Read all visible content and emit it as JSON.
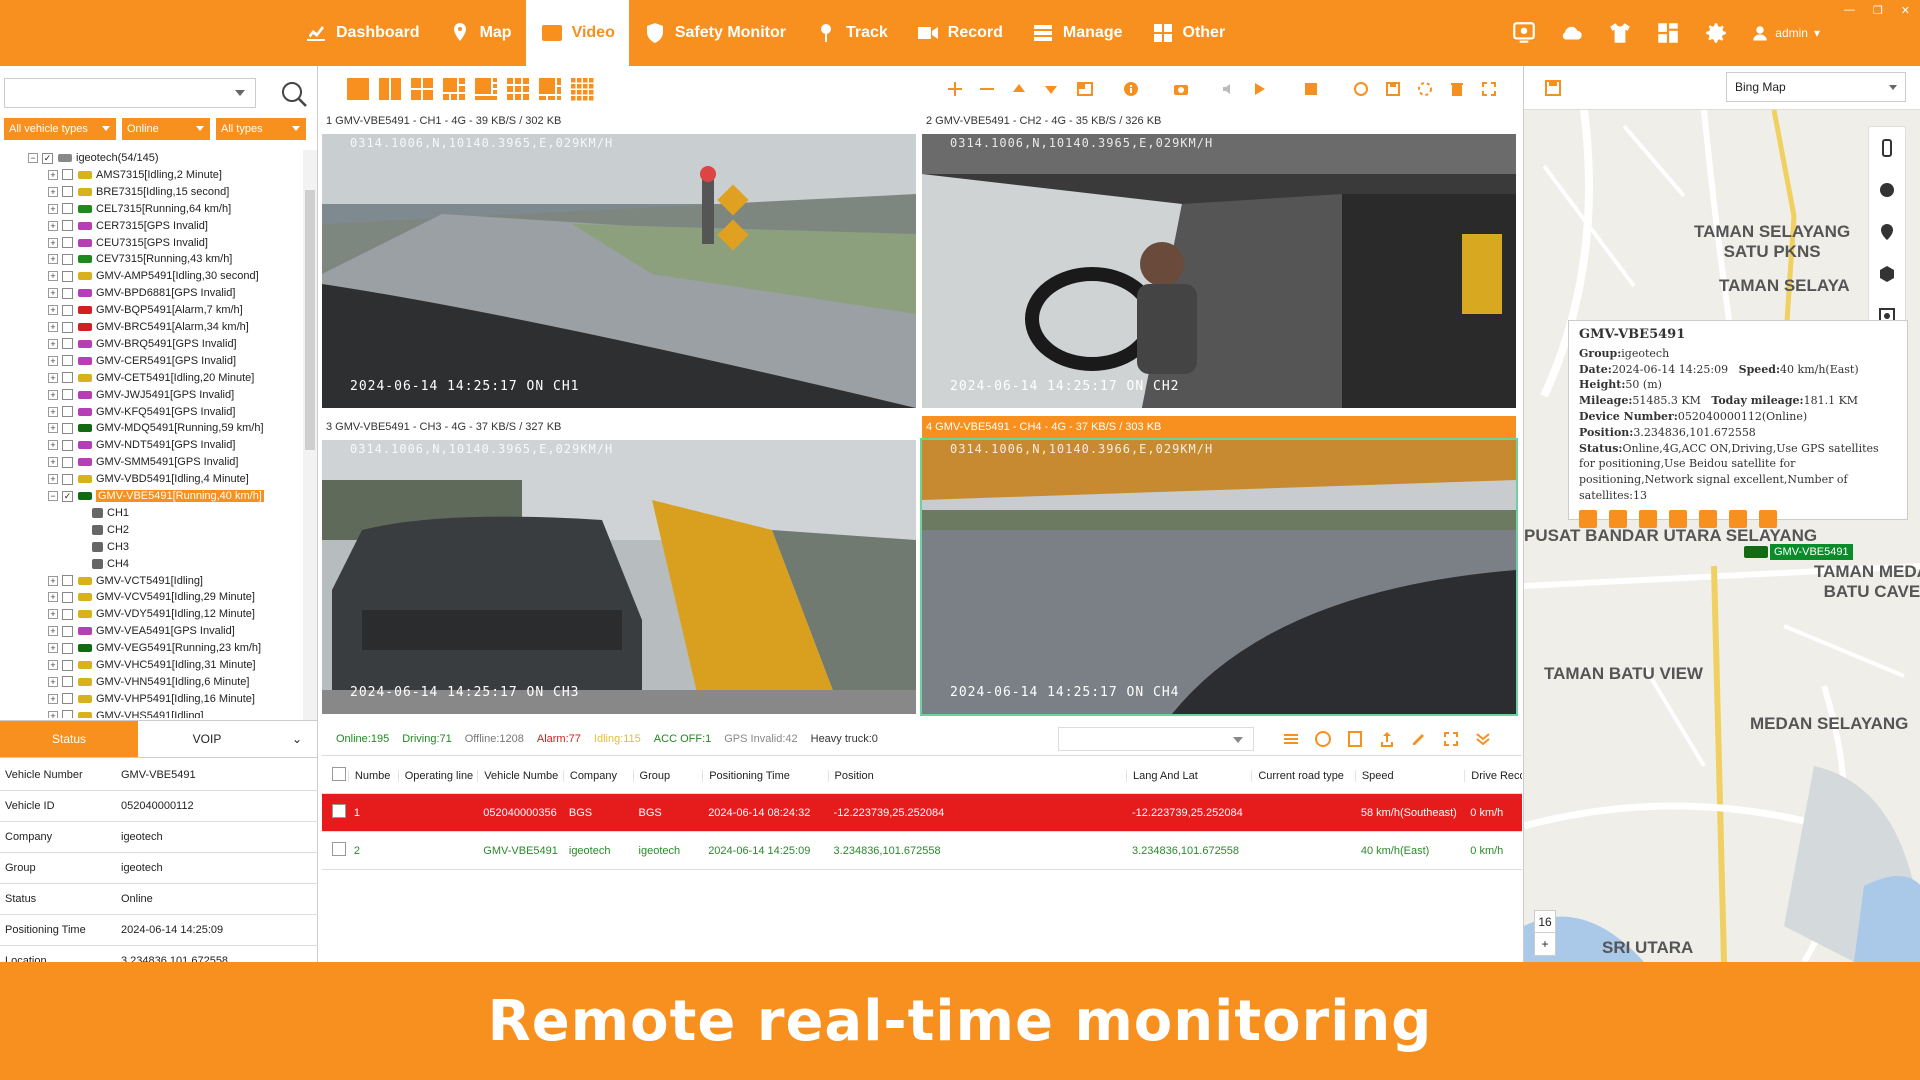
{
  "nav": {
    "items": [
      {
        "label": "Dashboard",
        "icon": "dashboard-icon",
        "active": false
      },
      {
        "label": "Map",
        "icon": "map-pin-icon",
        "active": false
      },
      {
        "label": "Video",
        "icon": "video-play-icon",
        "active": true
      },
      {
        "label": "Safety Monitor",
        "icon": "shield-icon",
        "active": false
      },
      {
        "label": "Track",
        "icon": "location-pin-icon",
        "active": false
      },
      {
        "label": "Record",
        "icon": "camera-icon",
        "active": false
      },
      {
        "label": "Manage",
        "icon": "manage-icon",
        "active": false
      },
      {
        "label": "Other",
        "icon": "grid-icon",
        "active": false
      }
    ],
    "user": "admin"
  },
  "left": {
    "filters": [
      "All vehicle types",
      "Online",
      "All types"
    ],
    "tree": {
      "root": "igeotech(54/145)",
      "vehicles": [
        {
          "label": "AMS7315[Idling,2 Minute]",
          "color": "#d7b21c"
        },
        {
          "label": "BRE7315[Idling,15 second]",
          "color": "#d7b21c"
        },
        {
          "label": "CEL7315[Running,64 km/h]",
          "color": "#1d8a1d"
        },
        {
          "label": "CER7315[GPS Invalid]",
          "color": "#b63fb6"
        },
        {
          "label": "CEU7315[GPS Invalid]",
          "color": "#b63fb6"
        },
        {
          "label": "CEV7315[Running,43 km/h]",
          "color": "#1d8a1d"
        },
        {
          "label": "GMV-AMP5491[Idling,30 second]",
          "color": "#d7b21c"
        },
        {
          "label": "GMV-BPD6881[GPS Invalid]",
          "color": "#b63fb6"
        },
        {
          "label": "GMV-BQP5491[Alarm,7 km/h]",
          "color": "#d21f1f"
        },
        {
          "label": "GMV-BRC5491[Alarm,34 km/h]",
          "color": "#d21f1f"
        },
        {
          "label": "GMV-BRQ5491[GPS Invalid]",
          "color": "#b63fb6"
        },
        {
          "label": "GMV-CER5491[GPS Invalid]",
          "color": "#b63fb6"
        },
        {
          "label": "GMV-CET5491[Idling,20 Minute]",
          "color": "#d7b21c"
        },
        {
          "label": "GMV-JWJ5491[GPS Invalid]",
          "color": "#b63fb6"
        },
        {
          "label": "GMV-KFQ5491[GPS Invalid]",
          "color": "#b63fb6"
        },
        {
          "label": "GMV-MDQ5491[Running,59 km/h]",
          "color": "#126b12"
        },
        {
          "label": "GMV-NDT5491[GPS Invalid]",
          "color": "#b63fb6"
        },
        {
          "label": "GMV-SMM5491[GPS Invalid]",
          "color": "#b63fb6"
        },
        {
          "label": "GMV-VBD5491[Idling,4 Minute]",
          "color": "#d7b21c"
        },
        {
          "label": "GMV-VBE5491[Running,40 km/h]",
          "color": "#126b12",
          "selected": true
        }
      ],
      "channels": [
        "CH1",
        "CH2",
        "CH3",
        "CH4"
      ],
      "vehicles_after": [
        {
          "label": "GMV-VCT5491[Idling]",
          "color": "#d7b21c"
        },
        {
          "label": "GMV-VCV5491[Idling,29 Minute]",
          "color": "#d7b21c"
        },
        {
          "label": "GMV-VDY5491[Idling,12 Minute]",
          "color": "#d7b21c"
        },
        {
          "label": "GMV-VEA5491[GPS Invalid]",
          "color": "#b63fb6"
        },
        {
          "label": "GMV-VEG5491[Running,23 km/h]",
          "color": "#126b12"
        },
        {
          "label": "GMV-VHC5491[Idling,31 Minute]",
          "color": "#d7b21c"
        },
        {
          "label": "GMV-VHN5491[Idling,6 Minute]",
          "color": "#d7b21c"
        },
        {
          "label": "GMV-VHP5491[Idling,16 Minute]",
          "color": "#d7b21c"
        },
        {
          "label": "GMV-VHS5491[Idling]",
          "color": "#d7b21c"
        }
      ]
    },
    "tabs": [
      "Status",
      "VOIP"
    ],
    "info": [
      {
        "k": "Vehicle Number",
        "v": "GMV-VBE5491"
      },
      {
        "k": "Vehicle ID",
        "v": "052040000112"
      },
      {
        "k": "Company",
        "v": "igeotech"
      },
      {
        "k": "Group",
        "v": "igeotech"
      },
      {
        "k": "Status",
        "v": "Online"
      },
      {
        "k": "Positioning Time",
        "v": "2024-06-14 14:25:09"
      },
      {
        "k": "Location",
        "v": "3.234836,101.672558"
      }
    ]
  },
  "video": {
    "cells": [
      {
        "header": "1  GMV-VBE5491 - CH1 - 4G - 39 KB/S / 302 KB",
        "osd_top": "0314.1006,N,10140.3965,E,029KM/H",
        "osd_bottom": "2024-06-14 14:25:17 ON  CH1",
        "active": false
      },
      {
        "header": "2  GMV-VBE5491 - CH2 - 4G - 35 KB/S / 326 KB",
        "osd_top": "0314.1006,N,10140.3965,E,029KM/H",
        "osd_bottom": "2024-06-14 14:25:17 ON  CH2",
        "active": false
      },
      {
        "header": "3  GMV-VBE5491 - CH3 - 4G - 37 KB/S / 327 KB",
        "osd_top": "0314.1006,N,10140.3965,E,029KM/H",
        "osd_bottom": "2024-06-14 14:25:17 ON  CH3",
        "active": false
      },
      {
        "header": "4  GMV-VBE5491 - CH4 - 4G - 37 KB/S / 303 KB",
        "osd_top": "0314.1006,N,10140.3966,E,029KM/H",
        "osd_bottom": "2024-06-14 14:25:17 ON  CH4",
        "active": true
      }
    ]
  },
  "status": {
    "items": [
      {
        "text": "Online:195",
        "color": "#1f8a1f"
      },
      {
        "text": "Driving:71",
        "color": "#1f8a1f"
      },
      {
        "text": "Offline:1208",
        "color": "#777777"
      },
      {
        "text": "Alarm:77",
        "color": "#d21f1f"
      },
      {
        "text": "Idling:115",
        "color": "#e0c040"
      },
      {
        "text": "ACC OFF:1",
        "color": "#1f8a1f"
      },
      {
        "text": "GPS Invalid:42",
        "color": "#888888"
      },
      {
        "text": "Heavy truck:0",
        "color": "#333333"
      }
    ]
  },
  "table": {
    "headers": [
      "Numbe",
      "Operating line",
      "Vehicle Numbe",
      "Company",
      "Group",
      "Positioning Time",
      "Position",
      "Lang And Lat",
      "Current road type",
      "Speed",
      "Drive Recor"
    ],
    "rows": [
      {
        "cells": [
          "1",
          "",
          "052040000356",
          "BGS",
          "BGS",
          "2024-06-14 08:24:32",
          "-12.223739,25.252084",
          "-12.223739,25.252084",
          "",
          "58 km/h(Southeast)",
          "0 km/h"
        ],
        "type": "alarm"
      },
      {
        "cells": [
          "2",
          "",
          "GMV-VBE5491",
          "igeotech",
          "igeotech",
          "2024-06-14 14:25:09",
          "3.234836,101.672558",
          "3.234836,101.672558",
          "",
          "40 km/h(East)",
          "0 km/h"
        ],
        "type": "ok"
      }
    ]
  },
  "map": {
    "provider": "Bing Map",
    "labels": [
      {
        "text": "TAMAN SELAYANG\nSATU PKNS"
      },
      {
        "text": "TAMAN SELAYA"
      },
      {
        "text": "PUSAT BANDAR UTARA SELAYANG"
      },
      {
        "text": "TAMAN MEDAN\nBATU CAVES"
      },
      {
        "text": "TAMAN BATU VIEW"
      },
      {
        "text": "MEDAN SELAYANG"
      },
      {
        "text": "SRI UTARA"
      }
    ],
    "popup": {
      "title": "GMV-VBE5491",
      "lines": [
        {
          "k": "Group:",
          "v": "igeotech"
        },
        {
          "k": "Date:",
          "v": "2024-06-14 14:25:09",
          "k2": "Speed:",
          "v2": "40 km/h(East)"
        },
        {
          "k": "Height:",
          "v": "50 (m)"
        },
        {
          "k": "Mileage:",
          "v": "51485.3 KM",
          "k2": "Today mileage:",
          "v2": "181.1 KM"
        },
        {
          "k": "Device Number:",
          "v": "052040000112(Online)"
        },
        {
          "k": "Position:",
          "v": "3.234836,101.672558"
        },
        {
          "k": "Status:",
          "v": "Online,4G,ACC ON,Driving,Use GPS satellites for positioning,Use Beidou satellite for positioning,Network signal excellent,Number of satellites:13"
        }
      ]
    },
    "marker": "GMV-VBE5491",
    "zoom_level": "16"
  },
  "banner": "Remote real-time monitoring",
  "colors": {
    "accent": "#f7901e",
    "alarm": "#e61b1b",
    "running": "#126b12"
  }
}
